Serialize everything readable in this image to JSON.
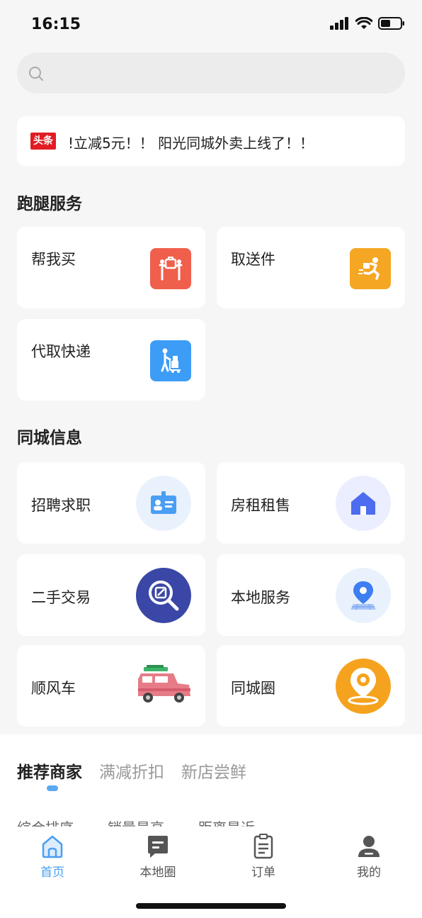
{
  "status_bar": {
    "time": "16:15"
  },
  "search": {
    "placeholder": ""
  },
  "notice": {
    "badge": "头条",
    "text": "!立减5元！！ 阳光同城外卖上线了！！"
  },
  "errand_section": {
    "title": "跑腿服务",
    "items": [
      {
        "label": "帮我买",
        "icon": "shopping-hands-icon",
        "color": "#ef5f4b"
      },
      {
        "label": "取送件",
        "icon": "running-courier-icon",
        "color": "#f5a623"
      },
      {
        "label": "代取快递",
        "icon": "parcel-cart-icon",
        "color": "#3d9cf5"
      }
    ]
  },
  "city_section": {
    "title": "同城信息",
    "items": [
      {
        "label": "招聘求职",
        "icon": "id-card-icon"
      },
      {
        "label": "房租租售",
        "icon": "house-icon"
      },
      {
        "label": "二手交易",
        "icon": "search-edit-icon"
      },
      {
        "label": "本地服务",
        "icon": "location-pin-icon"
      },
      {
        "label": "顺风车",
        "icon": "car-icon"
      },
      {
        "label": "同城圈",
        "icon": "map-pin-gear-icon"
      }
    ]
  },
  "merchant_tabs": [
    {
      "label": "推荐商家",
      "active": true
    },
    {
      "label": "满减折扣",
      "active": false
    },
    {
      "label": "新店尝鲜",
      "active": false
    }
  ],
  "sort_options": [
    "综合排序",
    "销量最高",
    "距离最近"
  ],
  "bottom_nav": [
    {
      "label": "首页",
      "icon": "home-icon",
      "active": true
    },
    {
      "label": "本地圈",
      "icon": "chat-icon",
      "active": false
    },
    {
      "label": "订单",
      "icon": "order-icon",
      "active": false
    },
    {
      "label": "我的",
      "icon": "profile-icon",
      "active": false
    }
  ],
  "colors": {
    "accent": "#4a9ef3",
    "badge": "#e11d23"
  }
}
